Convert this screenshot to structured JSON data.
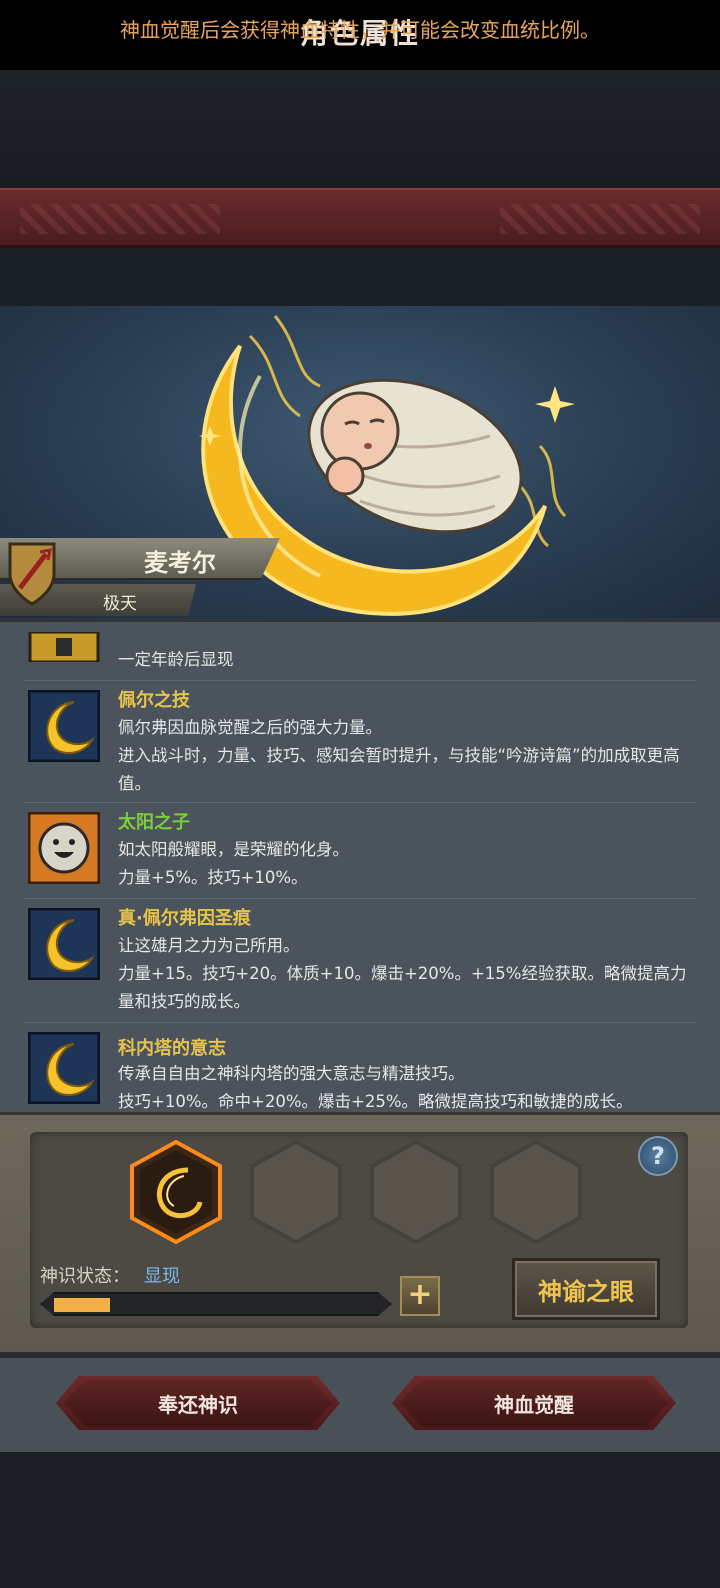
{
  "header": {
    "title": "角色属性"
  },
  "hint": "神血觉醒后会获得神血特性，并可能会改变血统比例。",
  "character": {
    "name": "麦考尔",
    "rank": "极天"
  },
  "traits": [
    {
      "name": "",
      "desc": "一定年龄后显现",
      "icon": "locked-tower-icon"
    },
    {
      "name": "佩尔之技",
      "name_color": "#e7c34d",
      "desc": "佩尔弗因血脉觉醒之后的强大力量。\n进入战斗时，力量、技巧、感知会暂时提升，与技能“吟游诗篇”的加成取更高值。",
      "icon": "golden-moon-icon"
    },
    {
      "name": "太阳之子",
      "name_color": "#7ccf3a",
      "desc": "如太阳般耀眼，是荣耀的化身。\n力量+5%。技巧+10%。",
      "icon": "smiling-sun-icon"
    },
    {
      "name": "真·佩尔弗因圣痕",
      "name_color": "#e7c34d",
      "desc": "让这雄月之力为己所用。\n力量+15。技巧+20。体质+10。爆击+20%。+15%经验获取。略微提高力量和技巧的成长。",
      "icon": "golden-moon-icon"
    },
    {
      "name": "科内塔的意志",
      "name_color": "#e7c34d",
      "desc": "传承自自由之神科内塔的强大意志与精湛技巧。\n技巧+10%。命中+20%。爆击+25%。略微提高技巧和敏捷的成长。",
      "icon": "golden-moon-icon"
    }
  ],
  "awakening": {
    "status_label": "神识状态：",
    "status_value": "显现",
    "progress": 0.17,
    "oracle_button": "神谕之眼",
    "help": "?",
    "plus": "+"
  },
  "actions": {
    "return_button": "奉还神识",
    "awaken_button": "神血觉醒"
  },
  "colors": {
    "accent_gold": "#e7c34d",
    "title_red": "#5a2426",
    "hint_orange": "#e8a65a",
    "status_blue": "#79b7ea"
  }
}
